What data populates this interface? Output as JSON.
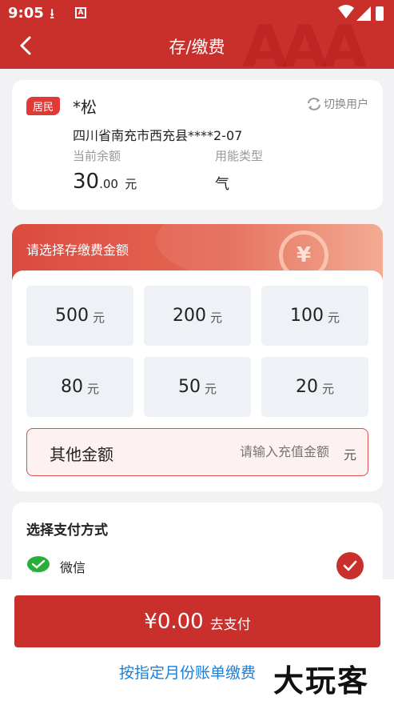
{
  "status_bar": {
    "time": "9:05"
  },
  "header": {
    "title": "存/缴费",
    "back_icon": "arrow-back-icon"
  },
  "user": {
    "badge": "居民",
    "name": "*松",
    "switch_label": "切换用户",
    "address": "四川省南充市西充县****2-07",
    "balance_label": "当前余额",
    "balance_int": "30",
    "balance_dec": ".00",
    "balance_unit": "元",
    "energy_type_label": "用能类型",
    "energy_type": "气"
  },
  "amount": {
    "title": "请选择存缴费金额",
    "unit": "元",
    "options": [
      "500",
      "200",
      "100",
      "80",
      "50",
      "20"
    ],
    "other_label": "其他金额",
    "other_placeholder": "请输入充值金额",
    "other_unit": "元"
  },
  "payment": {
    "title": "选择支付方式",
    "method": "微信",
    "selected": true
  },
  "bottom": {
    "pay_amount": "¥0.00",
    "pay_label": "去支付",
    "monthly_link": "按指定月份账单缴费",
    "watermark": "大玩客"
  },
  "colors": {
    "primary": "#c9302c",
    "link": "#1a7fd8",
    "wechat": "#2aae3a"
  }
}
